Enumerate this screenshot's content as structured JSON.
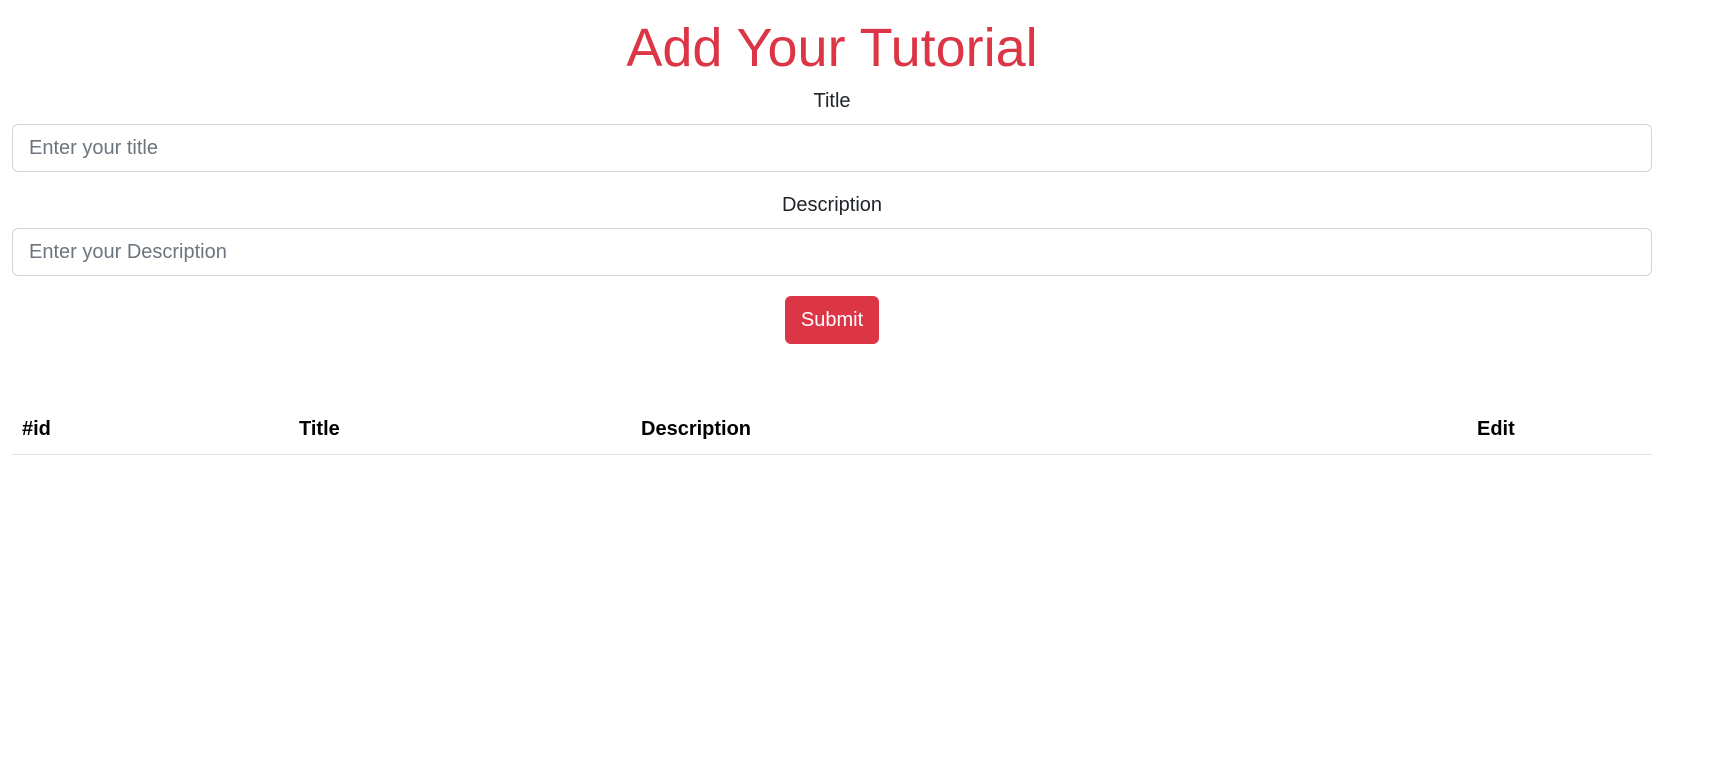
{
  "header": {
    "title": "Add Your Tutorial"
  },
  "form": {
    "title_label": "Title",
    "title_placeholder": "Enter your title",
    "title_value": "",
    "description_label": "Description",
    "description_placeholder": "Enter your Description",
    "description_value": "",
    "submit_label": "Submit"
  },
  "table": {
    "columns": [
      "#id",
      "Title",
      "Description",
      "Edit"
    ],
    "rows": []
  },
  "colors": {
    "accent": "#dc3545",
    "input_border": "#ced4da",
    "placeholder": "#6c757d",
    "table_border": "#dee2e6"
  }
}
